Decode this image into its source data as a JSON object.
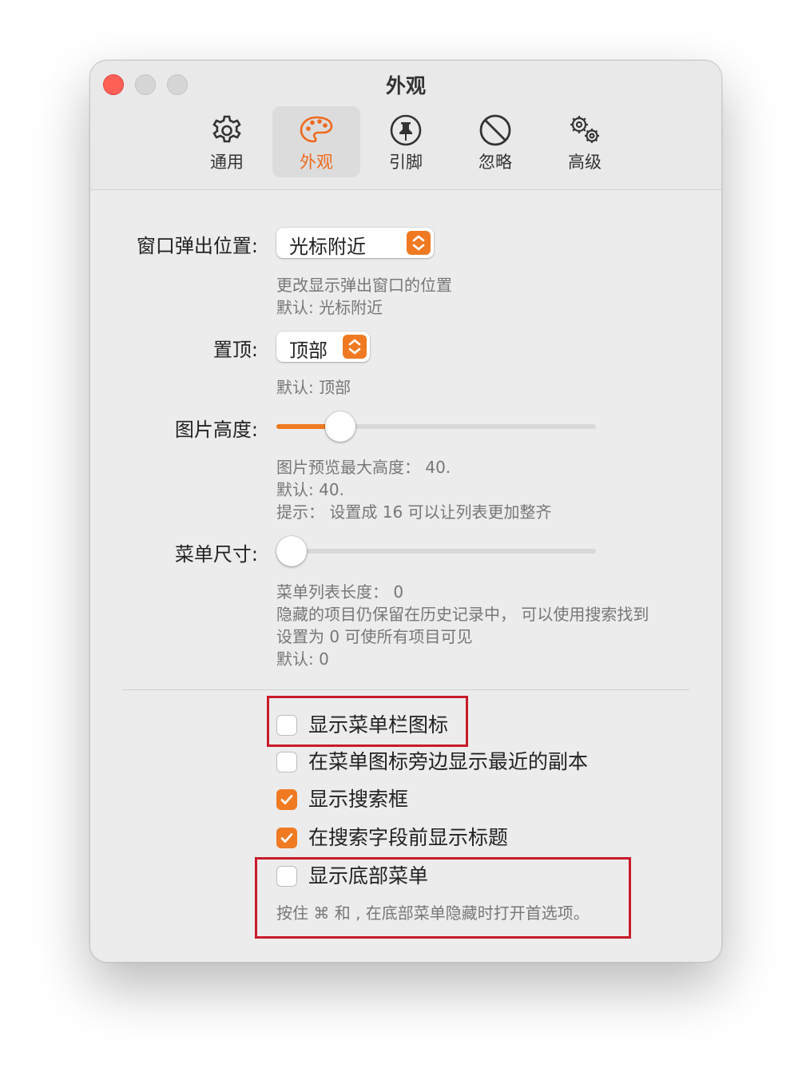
{
  "window": {
    "title": "外观"
  },
  "tabs": [
    {
      "label": "通用",
      "icon": "gear-icon",
      "active": false
    },
    {
      "label": "外观",
      "icon": "palette-icon",
      "active": true
    },
    {
      "label": "引脚",
      "icon": "pin-icon",
      "active": false
    },
    {
      "label": "忽略",
      "icon": "prohibit-icon",
      "active": false
    },
    {
      "label": "高级",
      "icon": "gears-icon",
      "active": false
    }
  ],
  "settings": {
    "popup_position": {
      "label": "窗口弹出位置:",
      "value": "光标附近",
      "help": [
        "更改显示弹出窗口的位置",
        "默认: 光标附近"
      ]
    },
    "pin_to": {
      "label": "置顶:",
      "value": "顶部",
      "help": [
        "默认: 顶部"
      ]
    },
    "image_height": {
      "label": "图片高度:",
      "level": 0.2,
      "help": [
        "图片预览最大高度：  40.",
        "默认: 40.",
        "提示：  设置成 16 可以让列表更加整齐"
      ]
    },
    "menu_size": {
      "label": "菜单尺寸:",
      "level": 0.0,
      "help": [
        "菜单列表长度：   0",
        "隐藏的项目仍保留在历史记录中，  可以使用搜索找到",
        "设置为 0 可使所有项目可见",
        "默认: 0"
      ]
    }
  },
  "checkboxes": [
    {
      "label": "显示菜单栏图标",
      "checked": false
    },
    {
      "label": "在菜单图标旁边显示最近的副本",
      "checked": false
    },
    {
      "label": "显示搜索框",
      "checked": true
    },
    {
      "label": "在搜索字段前显示标题",
      "checked": true
    },
    {
      "label": "显示底部菜单",
      "checked": false
    }
  ],
  "footer_note": "按住 ⌘ 和 , 在底部菜单隐藏时打开首选项。",
  "colors": {
    "accent": "#f07a22",
    "highlight_box": "#c81b2a"
  }
}
